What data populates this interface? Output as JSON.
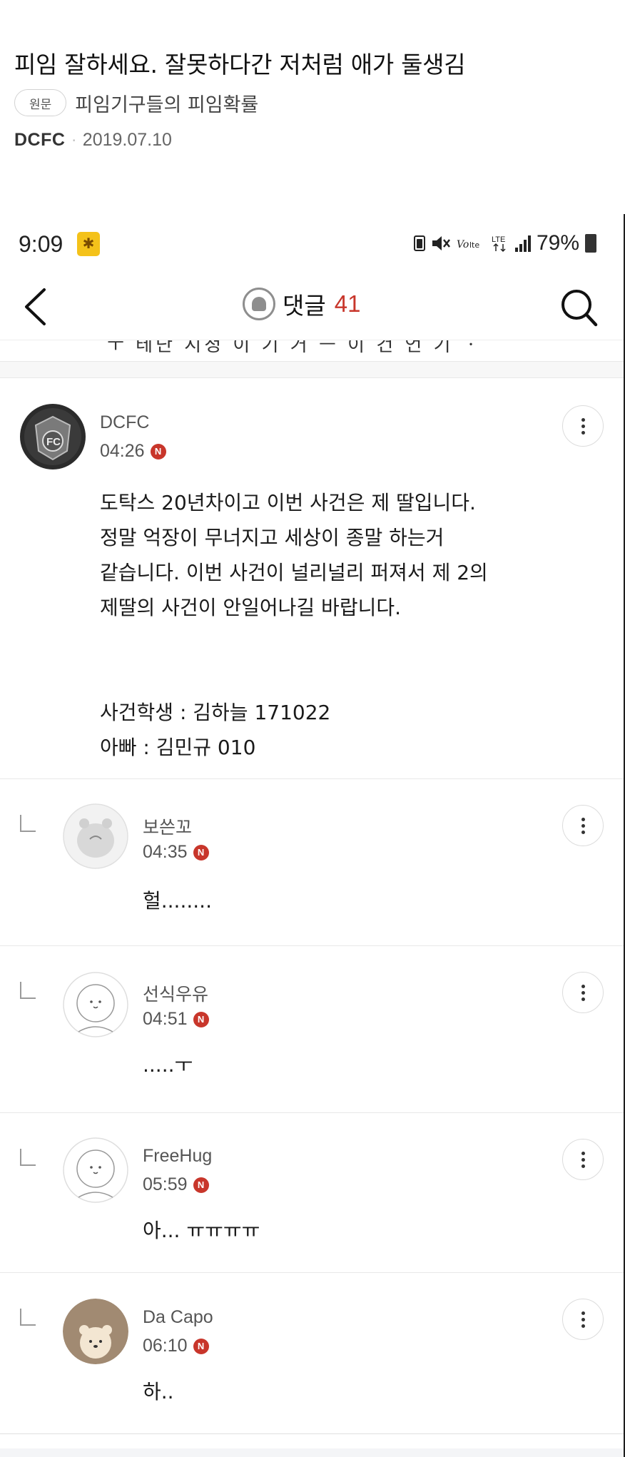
{
  "post": {
    "title": "피임 잘하세요. 잘못하다간 저처럼 애가 둘생김",
    "source_badge": "원문",
    "source_text": "피임기구들의 피임확률",
    "author": "DCFC",
    "separator": "·",
    "date": "2019.07.10"
  },
  "status_bar": {
    "time": "9:09",
    "battery": "79%"
  },
  "nav": {
    "title": "댓글",
    "count": "41"
  },
  "cutoff_text": "ㅜ 테단 시청 이 기 거 ㅡ 이 건 언 기 ㆍ",
  "comments": [
    {
      "name": "DCFC",
      "time": "04:26",
      "badge": "N",
      "lines": [
        "도탁스 20년차이고 이번 사건은 제 딸입니다.",
        "정말 억장이 무너지고 세상이 종말 하는거",
        "같습니다. 이번 사건이 널리널리 퍼져서 제 2의",
        "제딸의 사건이 안일어나길 바랍니다."
      ],
      "lines2": [
        "사건학생 : 김하늘 171022",
        "아빠 : 김민규 010"
      ]
    },
    {
      "name": "보쓴꼬",
      "time": "04:35",
      "badge": "N",
      "text": "헐........"
    },
    {
      "name": "선식우유",
      "time": "04:51",
      "badge": "N",
      "text": ".....ㅜ"
    },
    {
      "name": "FreeHug",
      "time": "05:59",
      "badge": "N",
      "text": "아... ㅠㅠㅠㅠ"
    },
    {
      "name": "Da Capo",
      "time": "06:10",
      "badge": "N",
      "text": "하.."
    }
  ]
}
